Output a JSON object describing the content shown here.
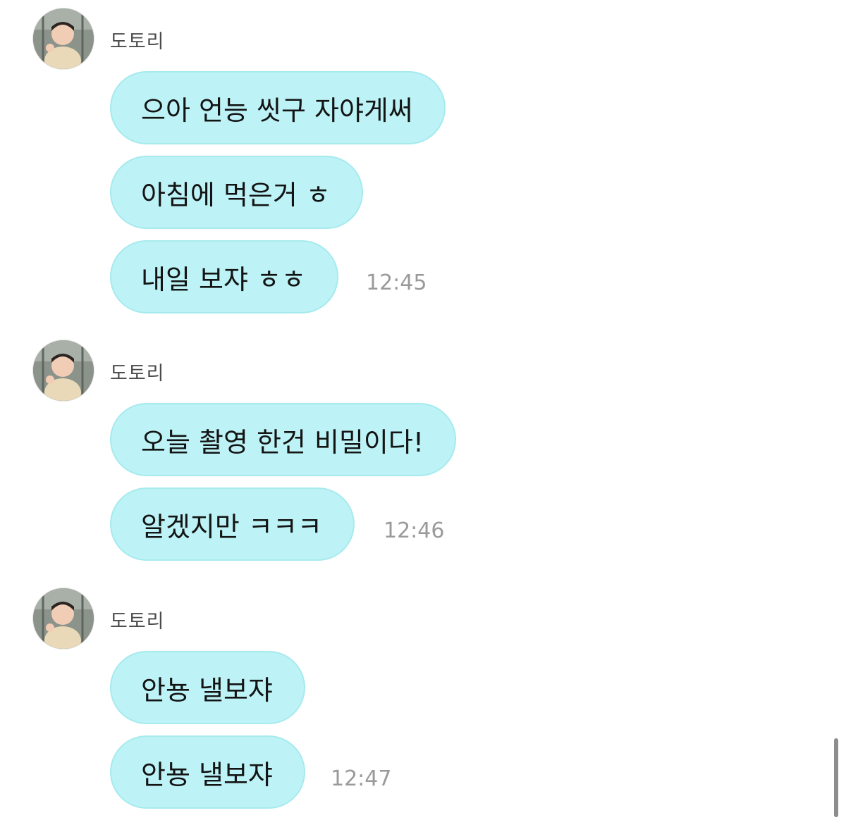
{
  "groups": [
    {
      "sender": "도토리",
      "messages": [
        "으아 언능 씻구 자야게써",
        "아침에 먹은거 ㅎ",
        "내일 보쟈 ㅎㅎ"
      ],
      "time": "12:45"
    },
    {
      "sender": "도토리",
      "messages": [
        "오늘 촬영 한건 비밀이다!",
        "알겠지만 ㅋㅋㅋ"
      ],
      "time": "12:46"
    },
    {
      "sender": "도토리",
      "messages": [
        "안뇽 낼보쟈",
        "안뇽 낼보쟈"
      ],
      "time": "12:47"
    }
  ],
  "colors": {
    "bubble": "#bdf3f6",
    "bubble_border": "#a6eaee",
    "timestamp": "#9a9a9a"
  }
}
